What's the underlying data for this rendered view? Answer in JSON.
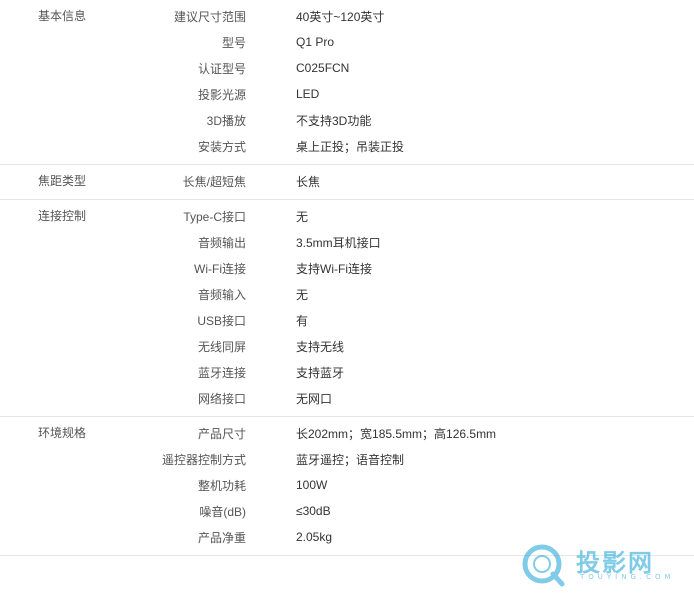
{
  "sections": [
    {
      "title": "基本信息",
      "rows": [
        {
          "label": "建议尺寸范围",
          "value": "40英寸~120英寸"
        },
        {
          "label": "型号",
          "value": "Q1 Pro"
        },
        {
          "label": "认证型号",
          "value": "C025FCN"
        },
        {
          "label": "投影光源",
          "value": "LED"
        },
        {
          "label": "3D播放",
          "value": "不支持3D功能"
        },
        {
          "label": "安装方式",
          "value": "桌上正投；吊装正投"
        }
      ]
    },
    {
      "title": "焦距类型",
      "rows": [
        {
          "label": "长焦/超短焦",
          "value": "长焦"
        }
      ]
    },
    {
      "title": "连接控制",
      "rows": [
        {
          "label": "Type-C接口",
          "value": "无"
        },
        {
          "label": "音频输出",
          "value": "3.5mm耳机接口"
        },
        {
          "label": "Wi-Fi连接",
          "value": "支持Wi-Fi连接"
        },
        {
          "label": "音频输入",
          "value": "无"
        },
        {
          "label": "USB接口",
          "value": "有"
        },
        {
          "label": "无线同屏",
          "value": "支持无线"
        },
        {
          "label": "蓝牙连接",
          "value": "支持蓝牙"
        },
        {
          "label": "网络接口",
          "value": "无网口"
        }
      ]
    },
    {
      "title": "环境规格",
      "rows": [
        {
          "label": "产品尺寸",
          "value": "长202mm；宽185.5mm；高126.5mm"
        },
        {
          "label": "遥控器控制方式",
          "value": "蓝牙遥控；语音控制"
        },
        {
          "label": "整机功耗",
          "value": "100W"
        },
        {
          "label": "噪音(dB)",
          "value": "≤30dB"
        },
        {
          "label": "产品净重",
          "value": "2.05kg"
        }
      ]
    }
  ],
  "watermark": {
    "brand": "投影网",
    "domain": "TOUYING.COM",
    "color": "#1aa3d6"
  }
}
